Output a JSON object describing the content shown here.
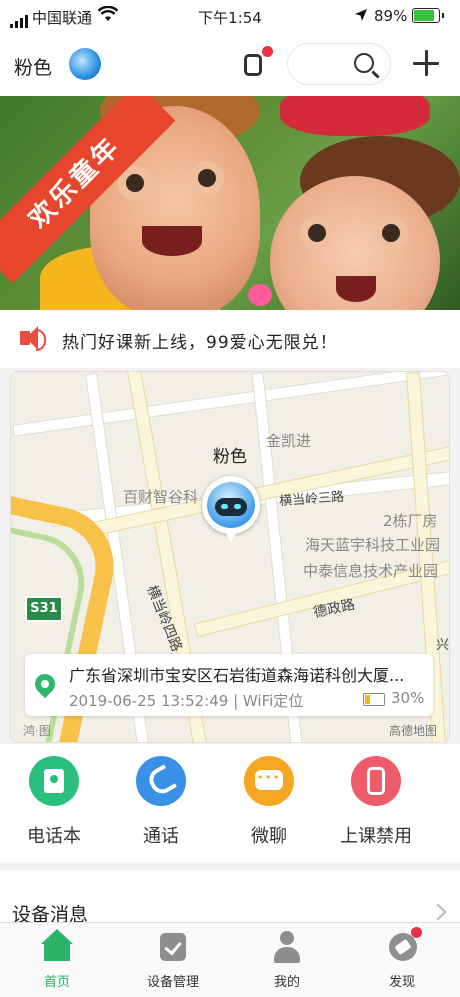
{
  "status_bar": {
    "carrier": "中国联通",
    "time": "下午1:54",
    "battery_pct": "89%",
    "battery_level": 0.89
  },
  "header": {
    "device_name": "粉色",
    "icons": [
      "device-avatar",
      "watch-icon",
      "search-icon",
      "plus-icon"
    ]
  },
  "banner": {
    "ribbon_text": "欢乐童年",
    "slides_total": 5,
    "active_slide": 3
  },
  "notice": {
    "text": "热门好课新上线，99爱心无限兑！"
  },
  "map": {
    "pin_label": "粉色",
    "labels": {
      "jinkaijin": "金凯进",
      "baicai": "百财智谷科",
      "hengdang3": "横当岭三路",
      "building2": "2栋厂房",
      "haitian": "海天蓝宇科技工业园",
      "zhongtai": "中泰信息技术产业园",
      "hengdang4": "横当岭四路",
      "dezheng": "德政路",
      "xing": "兴",
      "s31": "S31",
      "amap": "高德地图",
      "map_bottom_left": "鸿·图"
    },
    "address": "广东省深圳市宝安区石岩街道森海诺科创大厦...",
    "timestamp": "2019-06-25 13:52:49 | WiFi定位",
    "device_battery_pct": "30%",
    "device_battery_level": 0.3
  },
  "quick_actions": [
    {
      "label": "电话本",
      "color": "#2bbf7e"
    },
    {
      "label": "通话",
      "color": "#3a8fe6"
    },
    {
      "label": "微聊",
      "color": "#f5a623"
    },
    {
      "label": "上课禁用",
      "color": "#ee5b6b"
    }
  ],
  "device_messages": {
    "title": "设备消息"
  },
  "tabs": [
    {
      "label": "首页",
      "active": true
    },
    {
      "label": "设备管理",
      "active": false
    },
    {
      "label": "我的",
      "active": false
    },
    {
      "label": "发现",
      "active": false,
      "badge": true
    }
  ],
  "colors": {
    "accent_green": "#28b06a",
    "badge_red": "#ec2f46",
    "speaker_red": "#ea4d3d"
  }
}
